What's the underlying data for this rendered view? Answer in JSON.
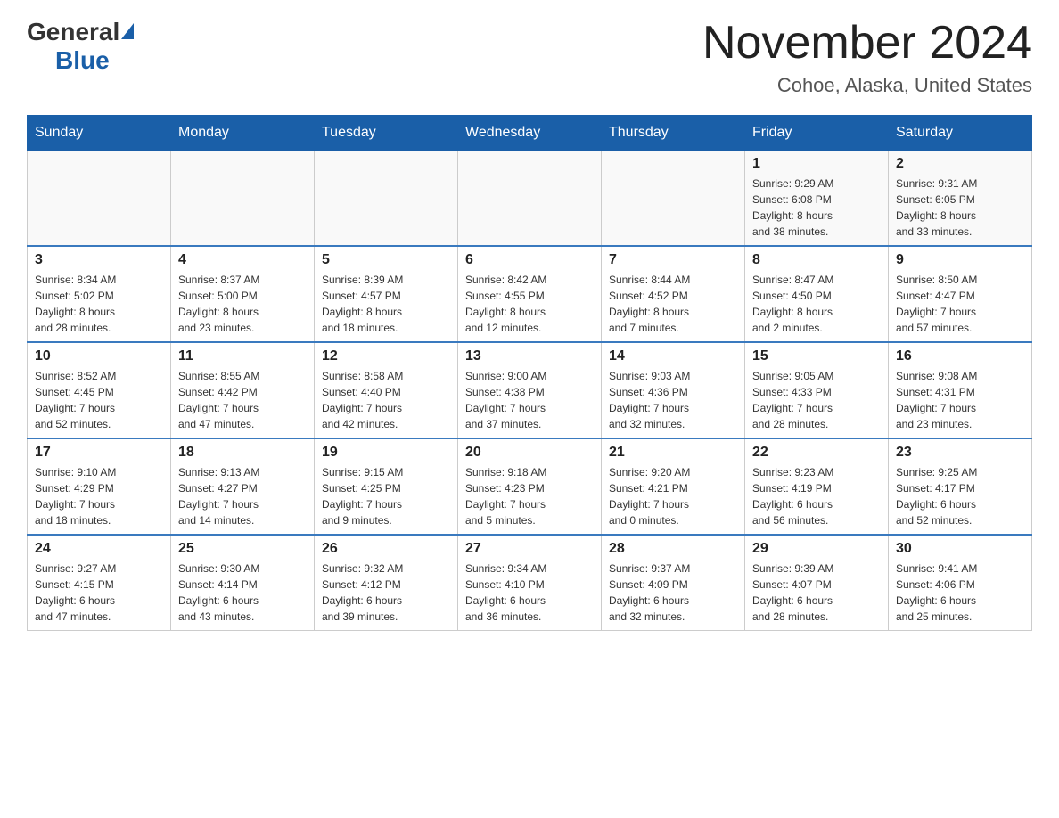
{
  "header": {
    "logo_general": "General",
    "logo_blue": "Blue",
    "title": "November 2024",
    "subtitle": "Cohoe, Alaska, United States"
  },
  "calendar": {
    "days_of_week": [
      "Sunday",
      "Monday",
      "Tuesday",
      "Wednesday",
      "Thursday",
      "Friday",
      "Saturday"
    ],
    "weeks": [
      [
        {
          "day": "",
          "info": ""
        },
        {
          "day": "",
          "info": ""
        },
        {
          "day": "",
          "info": ""
        },
        {
          "day": "",
          "info": ""
        },
        {
          "day": "",
          "info": ""
        },
        {
          "day": "1",
          "info": "Sunrise: 9:29 AM\nSunset: 6:08 PM\nDaylight: 8 hours\nand 38 minutes."
        },
        {
          "day": "2",
          "info": "Sunrise: 9:31 AM\nSunset: 6:05 PM\nDaylight: 8 hours\nand 33 minutes."
        }
      ],
      [
        {
          "day": "3",
          "info": "Sunrise: 8:34 AM\nSunset: 5:02 PM\nDaylight: 8 hours\nand 28 minutes."
        },
        {
          "day": "4",
          "info": "Sunrise: 8:37 AM\nSunset: 5:00 PM\nDaylight: 8 hours\nand 23 minutes."
        },
        {
          "day": "5",
          "info": "Sunrise: 8:39 AM\nSunset: 4:57 PM\nDaylight: 8 hours\nand 18 minutes."
        },
        {
          "day": "6",
          "info": "Sunrise: 8:42 AM\nSunset: 4:55 PM\nDaylight: 8 hours\nand 12 minutes."
        },
        {
          "day": "7",
          "info": "Sunrise: 8:44 AM\nSunset: 4:52 PM\nDaylight: 8 hours\nand 7 minutes."
        },
        {
          "day": "8",
          "info": "Sunrise: 8:47 AM\nSunset: 4:50 PM\nDaylight: 8 hours\nand 2 minutes."
        },
        {
          "day": "9",
          "info": "Sunrise: 8:50 AM\nSunset: 4:47 PM\nDaylight: 7 hours\nand 57 minutes."
        }
      ],
      [
        {
          "day": "10",
          "info": "Sunrise: 8:52 AM\nSunset: 4:45 PM\nDaylight: 7 hours\nand 52 minutes."
        },
        {
          "day": "11",
          "info": "Sunrise: 8:55 AM\nSunset: 4:42 PM\nDaylight: 7 hours\nand 47 minutes."
        },
        {
          "day": "12",
          "info": "Sunrise: 8:58 AM\nSunset: 4:40 PM\nDaylight: 7 hours\nand 42 minutes."
        },
        {
          "day": "13",
          "info": "Sunrise: 9:00 AM\nSunset: 4:38 PM\nDaylight: 7 hours\nand 37 minutes."
        },
        {
          "day": "14",
          "info": "Sunrise: 9:03 AM\nSunset: 4:36 PM\nDaylight: 7 hours\nand 32 minutes."
        },
        {
          "day": "15",
          "info": "Sunrise: 9:05 AM\nSunset: 4:33 PM\nDaylight: 7 hours\nand 28 minutes."
        },
        {
          "day": "16",
          "info": "Sunrise: 9:08 AM\nSunset: 4:31 PM\nDaylight: 7 hours\nand 23 minutes."
        }
      ],
      [
        {
          "day": "17",
          "info": "Sunrise: 9:10 AM\nSunset: 4:29 PM\nDaylight: 7 hours\nand 18 minutes."
        },
        {
          "day": "18",
          "info": "Sunrise: 9:13 AM\nSunset: 4:27 PM\nDaylight: 7 hours\nand 14 minutes."
        },
        {
          "day": "19",
          "info": "Sunrise: 9:15 AM\nSunset: 4:25 PM\nDaylight: 7 hours\nand 9 minutes."
        },
        {
          "day": "20",
          "info": "Sunrise: 9:18 AM\nSunset: 4:23 PM\nDaylight: 7 hours\nand 5 minutes."
        },
        {
          "day": "21",
          "info": "Sunrise: 9:20 AM\nSunset: 4:21 PM\nDaylight: 7 hours\nand 0 minutes."
        },
        {
          "day": "22",
          "info": "Sunrise: 9:23 AM\nSunset: 4:19 PM\nDaylight: 6 hours\nand 56 minutes."
        },
        {
          "day": "23",
          "info": "Sunrise: 9:25 AM\nSunset: 4:17 PM\nDaylight: 6 hours\nand 52 minutes."
        }
      ],
      [
        {
          "day": "24",
          "info": "Sunrise: 9:27 AM\nSunset: 4:15 PM\nDaylight: 6 hours\nand 47 minutes."
        },
        {
          "day": "25",
          "info": "Sunrise: 9:30 AM\nSunset: 4:14 PM\nDaylight: 6 hours\nand 43 minutes."
        },
        {
          "day": "26",
          "info": "Sunrise: 9:32 AM\nSunset: 4:12 PM\nDaylight: 6 hours\nand 39 minutes."
        },
        {
          "day": "27",
          "info": "Sunrise: 9:34 AM\nSunset: 4:10 PM\nDaylight: 6 hours\nand 36 minutes."
        },
        {
          "day": "28",
          "info": "Sunrise: 9:37 AM\nSunset: 4:09 PM\nDaylight: 6 hours\nand 32 minutes."
        },
        {
          "day": "29",
          "info": "Sunrise: 9:39 AM\nSunset: 4:07 PM\nDaylight: 6 hours\nand 28 minutes."
        },
        {
          "day": "30",
          "info": "Sunrise: 9:41 AM\nSunset: 4:06 PM\nDaylight: 6 hours\nand 25 minutes."
        }
      ]
    ]
  }
}
